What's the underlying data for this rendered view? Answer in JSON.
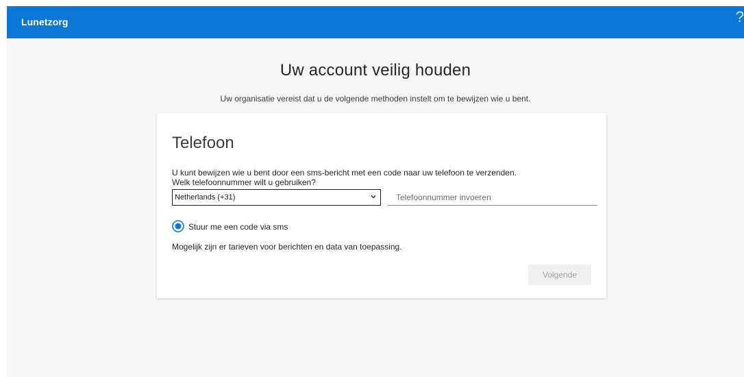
{
  "header": {
    "brand": "Lunetzorg",
    "help_glyph": "?",
    "background_color": "#0a78d4"
  },
  "page": {
    "title": "Uw account veilig houden",
    "subtitle": "Uw organisatie vereist dat u de volgende methoden instelt om te bewijzen wie u bent."
  },
  "card": {
    "title": "Telefoon",
    "description": "U kunt bewijzen wie u bent door een sms-bericht met een code naar uw telefoon te verzenden.",
    "question": "Welk telefoonnummer wilt u gebruiken?",
    "country_select": {
      "selected": "Netherlands (+31)"
    },
    "phone_input": {
      "value": "",
      "placeholder": "Telefoonnummer invoeren"
    },
    "method_option": {
      "label": "Stuur me een code via sms",
      "selected": true,
      "accent_color": "#0a78d4"
    },
    "fees_notice": "Mogelijk zijn er tarieven voor berichten en data van toepassing.",
    "next_button": {
      "label": "Volgende",
      "enabled": false
    }
  }
}
